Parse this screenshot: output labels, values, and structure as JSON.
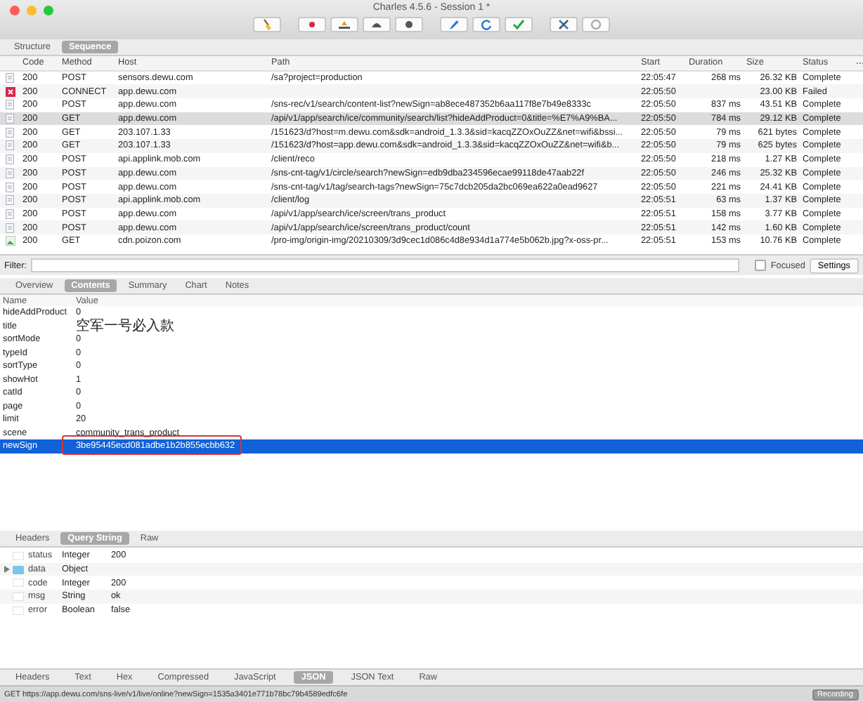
{
  "window": {
    "title": "Charles 4.5.6 - Session 1 *"
  },
  "toolbar": [
    {
      "kind": "broom"
    },
    {
      "kind": "record"
    },
    {
      "kind": "throttle"
    },
    {
      "kind": "turtle"
    },
    {
      "kind": "stop"
    },
    {
      "kind": "pen"
    },
    {
      "kind": "refresh"
    },
    {
      "kind": "check"
    },
    {
      "kind": "tools"
    },
    {
      "kind": "gear"
    }
  ],
  "view_tabs": [
    {
      "label": "Structure",
      "selected": false
    },
    {
      "label": "Sequence",
      "selected": true
    }
  ],
  "table": {
    "columns": [
      "Code",
      "Method",
      "Host",
      "Path",
      "Start",
      "Duration",
      "Size",
      "Status"
    ],
    "rows": [
      {
        "kind": "doc",
        "code": "200",
        "method": "POST",
        "host": "sensors.dewu.com",
        "path": "/sa?project=production",
        "start": "22:05:47",
        "duration": "268 ms",
        "size": "26.32 KB",
        "status": "Complete",
        "selected": false
      },
      {
        "kind": "failed",
        "code": "200",
        "method": "CONNECT",
        "host": "app.dewu.com",
        "path": "",
        "start": "22:05:50",
        "duration": "",
        "size": "23.00 KB",
        "status": "Failed",
        "selected": false
      },
      {
        "kind": "doc",
        "code": "200",
        "method": "POST",
        "host": "app.dewu.com",
        "path": "/sns-rec/v1/search/content-list?newSign=ab8ece487352b6aa117f8e7b49e8333c",
        "start": "22:05:50",
        "duration": "837 ms",
        "size": "43.51 KB",
        "status": "Complete",
        "selected": false
      },
      {
        "kind": "doc",
        "code": "200",
        "method": "GET",
        "host": "app.dewu.com",
        "path": "/api/v1/app/search/ice/community/search/list?hideAddProduct=0&title=%E7%A9%BA...",
        "start": "22:05:50",
        "duration": "784 ms",
        "size": "29.12 KB",
        "status": "Complete",
        "selected": true
      },
      {
        "kind": "doc",
        "code": "200",
        "method": "GET",
        "host": "203.107.1.33",
        "path": "/151623/d?host=m.dewu.com&sdk=android_1.3.3&sid=kacqZZOxOuZZ&net=wifi&bssi...",
        "start": "22:05:50",
        "duration": "79 ms",
        "size": "621 bytes",
        "status": "Complete",
        "selected": false
      },
      {
        "kind": "doc",
        "code": "200",
        "method": "GET",
        "host": "203.107.1.33",
        "path": "/151623/d?host=app.dewu.com&sdk=android_1.3.3&sid=kacqZZOxOuZZ&net=wifi&b...",
        "start": "22:05:50",
        "duration": "79 ms",
        "size": "625 bytes",
        "status": "Complete",
        "selected": false
      },
      {
        "kind": "doc",
        "code": "200",
        "method": "POST",
        "host": "api.applink.mob.com",
        "path": "/client/reco",
        "start": "22:05:50",
        "duration": "218 ms",
        "size": "1.27 KB",
        "status": "Complete",
        "selected": false
      },
      {
        "kind": "doc",
        "code": "200",
        "method": "POST",
        "host": "app.dewu.com",
        "path": "/sns-cnt-tag/v1/circle/search?newSign=edb9dba234596ecae99118de47aab22f",
        "start": "22:05:50",
        "duration": "246 ms",
        "size": "25.32 KB",
        "status": "Complete",
        "selected": false
      },
      {
        "kind": "doc",
        "code": "200",
        "method": "POST",
        "host": "app.dewu.com",
        "path": "/sns-cnt-tag/v1/tag/search-tags?newSign=75c7dcb205da2bc069ea622a0ead9627",
        "start": "22:05:50",
        "duration": "221 ms",
        "size": "24.41 KB",
        "status": "Complete",
        "selected": false
      },
      {
        "kind": "doc",
        "code": "200",
        "method": "POST",
        "host": "api.applink.mob.com",
        "path": "/client/log",
        "start": "22:05:51",
        "duration": "63 ms",
        "size": "1.37 KB",
        "status": "Complete",
        "selected": false
      },
      {
        "kind": "doc",
        "code": "200",
        "method": "POST",
        "host": "app.dewu.com",
        "path": "/api/v1/app/search/ice/screen/trans_product",
        "start": "22:05:51",
        "duration": "158 ms",
        "size": "3.77 KB",
        "status": "Complete",
        "selected": false
      },
      {
        "kind": "doc",
        "code": "200",
        "method": "POST",
        "host": "app.dewu.com",
        "path": "/api/v1/app/search/ice/screen/trans_product/count",
        "start": "22:05:51",
        "duration": "142 ms",
        "size": "1.60 KB",
        "status": "Complete",
        "selected": false
      },
      {
        "kind": "image",
        "code": "200",
        "method": "GET",
        "host": "cdn.poizon.com",
        "path": "/pro-img/origin-img/20210309/3d9cec1d086c4d8e934d1a774e5b062b.jpg?x-oss-pr...",
        "start": "22:05:51",
        "duration": "153 ms",
        "size": "10.76 KB",
        "status": "Complete",
        "selected": false
      }
    ]
  },
  "filter": {
    "label": "Filter:",
    "focused_label": "Focused",
    "focused": false,
    "settings": "Settings"
  },
  "detail_tabs": [
    {
      "label": "Overview",
      "selected": false
    },
    {
      "label": "Contents",
      "selected": true
    },
    {
      "label": "Summary",
      "selected": false
    },
    {
      "label": "Chart",
      "selected": false
    },
    {
      "label": "Notes",
      "selected": false
    }
  ],
  "params": {
    "columns": [
      "Name",
      "Value"
    ],
    "rows": [
      {
        "name": "hideAddProduct",
        "value": "0",
        "selected": false,
        "highlighted": false
      },
      {
        "name": "title",
        "value": "空军一号必入款",
        "selected": false,
        "highlighted": false
      },
      {
        "name": "sortMode",
        "value": "0",
        "selected": false,
        "highlighted": false
      },
      {
        "name": "typeId",
        "value": "0",
        "selected": false,
        "highlighted": false
      },
      {
        "name": "sortType",
        "value": "0",
        "selected": false,
        "highlighted": false
      },
      {
        "name": "showHot",
        "value": "1",
        "selected": false,
        "highlighted": false
      },
      {
        "name": "catId",
        "value": "0",
        "selected": false,
        "highlighted": false
      },
      {
        "name": "page",
        "value": "0",
        "selected": false,
        "highlighted": false
      },
      {
        "name": "limit",
        "value": "20",
        "selected": false,
        "highlighted": false
      },
      {
        "name": "scene",
        "value": "community_trans_product",
        "selected": false,
        "highlighted": false
      },
      {
        "name": "newSign",
        "value": "3be95445ecd081adbe1b2b855ecbb632",
        "selected": true,
        "highlighted": true
      }
    ]
  },
  "response_tabs": [
    {
      "label": "Headers",
      "selected": false
    },
    {
      "label": "Query String",
      "selected": true
    },
    {
      "label": "Raw",
      "selected": false
    }
  ],
  "json_tree": [
    {
      "key": "status",
      "type": "Integer",
      "value": "200",
      "expandable": false
    },
    {
      "key": "data",
      "type": "Object",
      "expandable": true
    },
    {
      "key": "code",
      "type": "Integer",
      "value": "200",
      "expandable": false
    },
    {
      "key": "msg",
      "type": "String",
      "value": "ok",
      "expandable": false
    },
    {
      "key": "error",
      "type": "Boolean",
      "value": "false",
      "expandable": false
    }
  ],
  "body_tabs": [
    {
      "label": "Headers",
      "selected": false
    },
    {
      "label": "Text",
      "selected": false
    },
    {
      "label": "Hex",
      "selected": false
    },
    {
      "label": "Compressed",
      "selected": false
    },
    {
      "label": "JavaScript",
      "selected": false
    },
    {
      "label": "JSON",
      "selected": true
    },
    {
      "label": "JSON Text",
      "selected": false
    },
    {
      "label": "Raw",
      "selected": false
    }
  ],
  "status_bar": {
    "text": "GET https://app.dewu.com/sns-live/v1/live/online?newSign=1535a3401e771b78bc79b4589edfc6fe",
    "recording": "Recording"
  }
}
